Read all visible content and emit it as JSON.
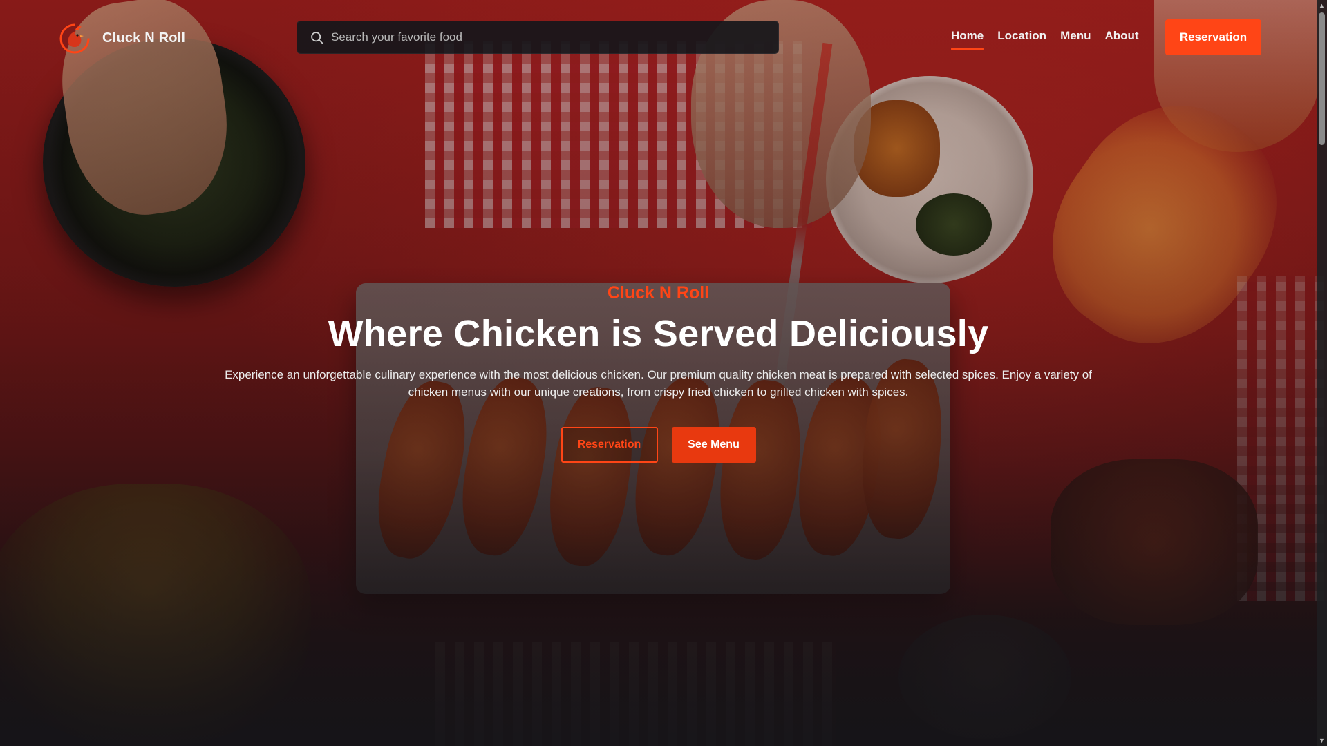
{
  "brand": {
    "name": "Cluck N Roll",
    "logo_icon": "rooster-flame-logo-icon"
  },
  "search": {
    "placeholder": "Search your favorite food",
    "value": "",
    "icon": "search-icon"
  },
  "nav": {
    "links": [
      {
        "label": "Home",
        "active": true
      },
      {
        "label": "Location",
        "active": false
      },
      {
        "label": "Menu",
        "active": false
      },
      {
        "label": "About",
        "active": false
      }
    ],
    "cta_label": "Reservation"
  },
  "hero": {
    "eyebrow": "Cluck N Roll",
    "title": "Where Chicken is Served Deliciously",
    "description": "Experience an unforgettable culinary experience with the most delicious chicken. Our premium quality chicken meat is prepared with selected spices. Enjoy a variety of chicken menus with our unique creations, from crispy fried chicken to grilled chicken with spices.",
    "primary_action": "Reservation",
    "secondary_action": "See Menu"
  },
  "colors": {
    "accent": "#ff4516",
    "button_solid": "#e8390f",
    "search_bg": "#16161a",
    "text_light": "#f2f2f2"
  }
}
